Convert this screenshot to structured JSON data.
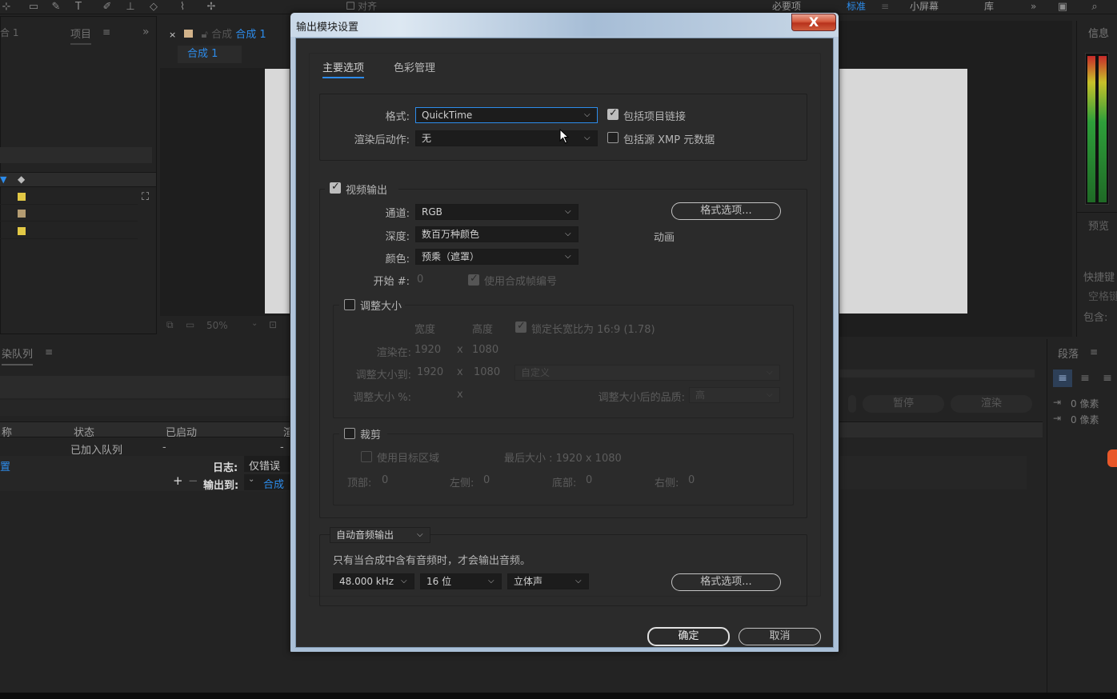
{
  "app": {
    "workspaces": [
      "必要项",
      "标准",
      "小屏幕",
      "库"
    ],
    "active_workspace": "标准",
    "toolbar_align_label": "对齐",
    "project_panel_label": "项目",
    "project_left_label": "合 1",
    "comp_tab_prefix": "合成",
    "comp_tab_name": "合成 1",
    "comp_sub_tab": "合成 1",
    "viewer_zoom": "50%",
    "info_panel_label": "信息",
    "preview_label": "预览",
    "shortcuts_label": "快捷键",
    "space_label": "空格键",
    "include_label": "包含:",
    "render_queue_tab": "染队列",
    "rq_columns": [
      "称",
      "状态",
      "已启动"
    ],
    "rq_col_extra": "渲",
    "rq_row_status": "已加入队列",
    "rq_row_dash": "-",
    "rq_row_dash2": "-",
    "rq_settings_label": "置",
    "log_label": "日志:",
    "log_value": "仅错误",
    "output_to_label": "输出到:",
    "output_to_value": "合成",
    "rq_buttons": [
      "暂停",
      "渲染"
    ],
    "paragraph_panel": "段落",
    "para_indent_1": "0 像素",
    "para_indent_2": "0 像素"
  },
  "dialog": {
    "title": "输出模块设置",
    "close_glyph": "X",
    "tabs": [
      "主要选项",
      "色彩管理"
    ],
    "format_label": "格式:",
    "format_value": "QuickTime",
    "post_render_label": "渲染后动作:",
    "post_render_value": "无",
    "include_project_link": "包括项目链接",
    "include_xmp": "包括源 XMP 元数据",
    "video_output": "视频输出",
    "channels_label": "通道:",
    "channels_value": "RGB",
    "depth_label": "深度:",
    "depth_value": "数百万种颜色",
    "color_label": "颜色:",
    "color_value": "预乘（遮罩）",
    "start_label": "开始 #:",
    "start_value": "0",
    "use_comp_frame": "使用合成帧编号",
    "format_options_btn": "格式选项...",
    "codec_label": "动画",
    "resize": {
      "title": "调整大小",
      "width_header": "宽度",
      "height_header": "高度",
      "lock_aspect": "锁定长宽比为 16:9 (1.78)",
      "render_at_label": "渲染在:",
      "render_at_w": "1920",
      "render_at_h": "1080",
      "resize_to_label": "调整大小到:",
      "resize_to_w": "1920",
      "resize_to_h": "1080",
      "preset_value": "自定义",
      "resize_pct_label": "调整大小 %:",
      "x_sep": "x",
      "quality_label": "调整大小后的品质:",
      "quality_value": "高"
    },
    "crop": {
      "title": "裁剪",
      "use_roi": "使用目标区域",
      "final_size": "最后大小 : 1920 x 1080",
      "top_label": "顶部:",
      "top_value": "0",
      "left_label": "左侧:",
      "left_value": "0",
      "bottom_label": "底部:",
      "bottom_value": "0",
      "right_label": "右侧:",
      "right_value": "0"
    },
    "audio": {
      "mode_value": "自动音频输出",
      "note": "只有当合成中含有音频时，才会输出音频。",
      "sample_rate": "48.000 kHz",
      "bit_depth": "16 位",
      "channels": "立体声",
      "format_options_btn": "格式选项..."
    },
    "ok_btn": "确定",
    "cancel_btn": "取消"
  },
  "colors": {
    "accent_blue": "#2d8ceb",
    "panel_bg": "#232323",
    "dialog_bg": "#2b2b2b",
    "close_red": "#c9462a",
    "label_yellow": "#e2c845",
    "label_tan": "#b49c72"
  },
  "icons": {
    "dropdown": "chevron-down-icon",
    "close": "close-icon",
    "tag": "tag-icon",
    "flowchart": "flowchart-icon"
  }
}
